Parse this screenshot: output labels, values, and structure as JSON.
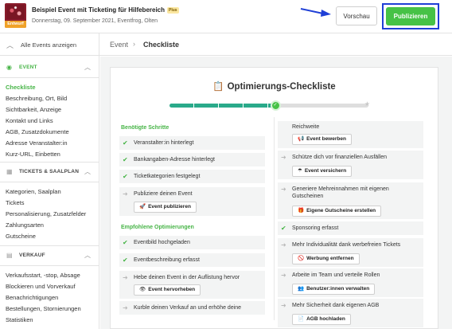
{
  "header": {
    "thumb_label": "Entwurf",
    "event_title": "Beispiel Event mit Ticketing für Hilfebereich",
    "plus_badge": "Plus",
    "event_subtitle": "Donnerstag, 09. September 2021, Eventfrog, Olten",
    "preview_label": "Vorschau",
    "publish_label": "Publizieren"
  },
  "sidebar": {
    "all_events": "Alle Events anzeigen",
    "sections": [
      {
        "title": "EVENT",
        "items": [
          "Checkliste",
          "Beschreibung, Ort, Bild",
          "Sichtbarkeit, Anzeige",
          "Kontakt und Links",
          "AGB, Zusatzdokumente",
          "Adresse Veranstalter:in",
          "Kurz-URL, Einbetten"
        ]
      },
      {
        "title": "TICKETS & SAALPLAN",
        "items": [
          "Kategorien, Saalplan",
          "Tickets",
          "Personalisierung, Zusatzfelder",
          "Zahlungsarten",
          "Gutscheine"
        ]
      },
      {
        "title": "VERKAUF",
        "items": [
          "Verkaufsstart, -stop, Absage",
          "Blockieren und Vorverkauf",
          "Benachrichtigungen",
          "Bestellungen, Stornierungen",
          "Statistiken"
        ]
      }
    ]
  },
  "breadcrumb": {
    "root": "Event",
    "current": "Checkliste"
  },
  "checklist": {
    "title": "Optimierungs-Checkliste",
    "progress_fraction": 0.53,
    "required_heading": "Benötigte Schritte",
    "required": [
      {
        "text": "Veranstalter:in hinterlegt",
        "done": true
      },
      {
        "text": "Bankangaben-Adresse hinterlegt",
        "done": true
      },
      {
        "text": "Ticketkategorien festgelegt",
        "done": true
      },
      {
        "text": "Publiziere deinen Event",
        "done": false,
        "button": "Event publizieren"
      }
    ],
    "recommended_heading": "Empfohlene Optimierungen",
    "recommended": [
      {
        "text": "Eventbild hochgeladen",
        "done": true
      },
      {
        "text": "Eventbeschreibung erfasst",
        "done": true
      },
      {
        "text": "Hebe deinen Event in der Auflistung hervor",
        "done": false,
        "button": "Event hervorheben"
      },
      {
        "text": "Kurble deinen Verkauf an und erhöhe deine",
        "done": false
      }
    ],
    "right": [
      {
        "text": "Reichweite",
        "done": false,
        "button": "Event bewerben"
      },
      {
        "text": "Schütze dich vor finanziellen Ausfällen",
        "done": false,
        "button": "Event versichern"
      },
      {
        "text": "Generiere Mehreinnahmen mit eigenen Gutscheinen",
        "done": false,
        "button": "Eigene Gutscheine erstellen"
      },
      {
        "text": "Sponsoring erfasst",
        "done": true
      },
      {
        "text": "Mehr Individualität dank werbefreien Tickets",
        "done": false,
        "button": "Werbung entfernen"
      },
      {
        "text": "Arbeite im Team und verteile Rollen",
        "done": false,
        "button": "Benutzer:innen verwalten"
      },
      {
        "text": "Mehr Sicherheit dank eigenen AGB",
        "done": false,
        "button": "AGB hochladen"
      }
    ]
  },
  "colors": {
    "accent": "#46c246",
    "highlight_border": "#1f3fd6",
    "progress": "#2aaa8a"
  }
}
